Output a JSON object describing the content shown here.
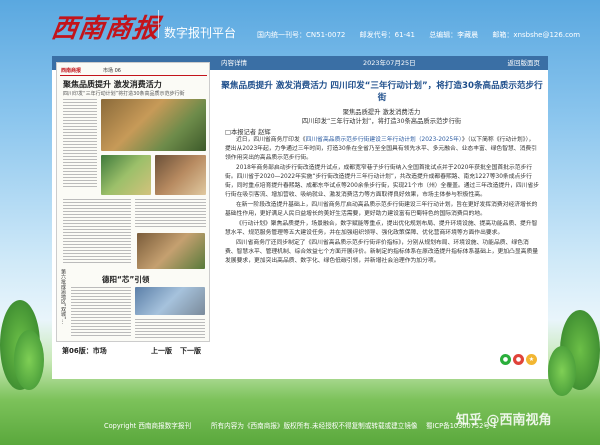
{
  "header": {
    "logo": "西南商报",
    "platform": "数字报刊平台",
    "info": {
      "issn": "国内统一刊号：CN51-0072",
      "post": "邮发代号：61-41",
      "editor": "总编辑：李藏晨",
      "email": "邮箱：xnsbshe@126.com"
    }
  },
  "topbar": {
    "left": "内容详情",
    "date": "2023年07月25日",
    "right": "返回版面页"
  },
  "paper": {
    "name": "西南商报",
    "section": "市场 06",
    "headline": "聚焦品质提升  激发消费活力",
    "subhead": "四川印发“三年行动计划”将打造30条高品质示范步行街",
    "headline2": "德阳“芯”引领",
    "vertical": "第六批成渝地区“双城”…"
  },
  "pager": {
    "page": "第06版：市场",
    "prev": "上一版",
    "next": "下一版"
  },
  "article": {
    "title": "聚焦品质提升 激发消费活力 四川印发“三年行动计划”，将打造30条高品质示范步行街",
    "sub1": "聚焦品质提升  激发消费活力",
    "sub2": "四川印发“三年行动计划”，将打造30条高品质示范步行街",
    "author": "□本报记者  赵辉",
    "p1a": "近日，四川省商务厅印发《",
    "p1link": "四川省高品质示范步行街建设三年行动计划（2023-2025年）",
    "p1b": "》（以下简称《行动计划》），提出从2023年起，力争通过三年时间，打造30条在全省乃至全国具有领先水平、多元融合、业态丰富、绿色智慧、消费引领作用突出的高品质示范步行街。",
    "p2": "2018年商务部启动步行街改造提升试点，成都宽窄巷子步行街纳入全国首批试点并于2020年获批全国首批示范步行街。四川省于2020—2022年实施“步行街改造提升三年行动计划”，共改造提升成都春熙路、南充1227等30条成点步行街，同时重点培育提升春熙路、成都东华试点等200余条步行街，实现21个市（州）全覆盖。通过三年改造提升，四川省步行街在吸引客流、增加营收、吸纳就业、激发消费活力等方面取得良好效果，市场主体参与积极性高。",
    "p3": "在新一阶段改造提升基础上，四川省商务厅启动高品质示范步行街建设三年行动计划，旨在更好发挥消费对经济增长的基础性作用，更好满足人民日益增长的美好生活需要，更好助力建设富有巴蜀特色的国际消费目的地。",
    "p4": "《行动计划》聚焦品质提升，场景融合，数字赋能等重点，提出优化规划布局、提升环境设施、提高功能品质、提升智慧水平、规范服务管理等五大建设任务，并在加强组织领导、强化政策保障、优化营商环境等方面作出要求。",
    "p5": "四川省商务厅还同步制定了《四川省高品质示范步行街评价指标》，分别从规划布局、环境设施、功能品质、绿色消费、智慧水平、管理机制、综合效益七个方面开展评价。新制定的指标体系在原改造提升指标体系基础上，更加凸显高质量发展要求，更加突出高品质、数字化、绿色低碳引领，并新增社会治理作为加分项。"
  },
  "footer": {
    "copyright": "Copyright 西南商报数字报刊",
    "notice": "所有内容为《西南商报》版权所有.未经授权不得复制或转载或建立镜像",
    "icp": "蜀ICP备10300752号-1"
  },
  "watermark": "知乎 @西南视角",
  "colors": {
    "brand_red": "#c3141b",
    "bar_blue": "#3a6fa5",
    "title_blue": "#1f4f8c"
  }
}
